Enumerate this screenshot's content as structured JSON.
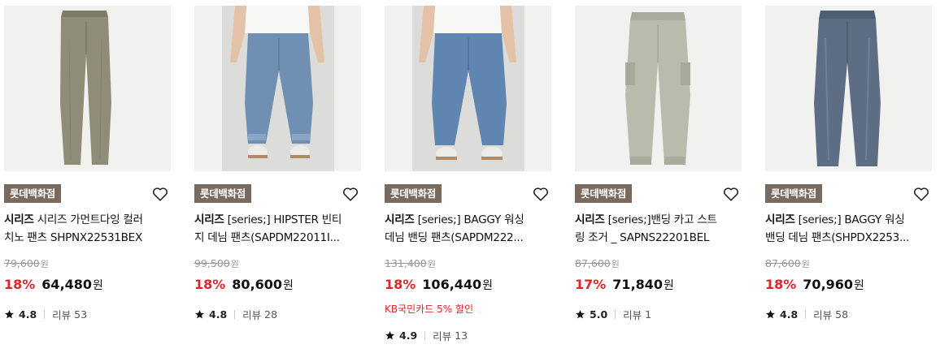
{
  "products": [
    {
      "badge": "롯데백화점",
      "brand": "시리즈",
      "title_line1": "시리즈 가먼트다잉 컬러",
      "title_line2": "치노 팬츠 SHPNX22531BEX",
      "original_price": "79,600",
      "discount": "18%",
      "price": "64,480",
      "currency": "원",
      "promo": "",
      "rating": "4.8",
      "review_label": "리뷰",
      "review_count": "53",
      "pant_color": "#8f8c78",
      "image": "khaki-chino-pants"
    },
    {
      "badge": "롯데백화점",
      "brand": "시리즈",
      "title_line1": "[series;] HIPSTER 빈티",
      "title_line2": "지 데님 팬츠(SAPDM22011I...",
      "original_price": "99,500",
      "discount": "18%",
      "price": "80,600",
      "currency": "원",
      "promo": "",
      "rating": "4.8",
      "review_label": "리뷰",
      "review_count": "28",
      "pant_color": "#6f90b3",
      "image": "model-light-denim"
    },
    {
      "badge": "롯데백화점",
      "brand": "시리즈",
      "title_line1": "[series;] BAGGY 워싱",
      "title_line2": "데님 밴딩 팬츠(SAPDM222...",
      "original_price": "131,400",
      "discount": "18%",
      "price": "106,440",
      "currency": "원",
      "promo": "KB국민카드 5% 할인",
      "rating": "4.9",
      "review_label": "리뷰",
      "review_count": "13",
      "pant_color": "#5f86b0",
      "image": "model-baggy-denim"
    },
    {
      "badge": "롯데백화점",
      "brand": "시리즈",
      "title_line1": "[series;]밴딩 카고 스트",
      "title_line2": "링 조거 _ SAPNS22201BEL",
      "original_price": "87,600",
      "discount": "17%",
      "price": "71,840",
      "currency": "원",
      "promo": "",
      "rating": "5.0",
      "review_label": "리뷰",
      "review_count": "1",
      "pant_color": "#b9bcad",
      "image": "cargo-jogger-pants"
    },
    {
      "badge": "롯데백화점",
      "brand": "시리즈",
      "title_line1": "[series;] BAGGY 워싱",
      "title_line2": "밴딩 데님 팬츠(SHPDX2253...",
      "original_price": "87,600",
      "discount": "18%",
      "price": "70,960",
      "currency": "원",
      "promo": "",
      "rating": "4.8",
      "review_label": "리뷰",
      "review_count": "58",
      "pant_color": "#5d6e84",
      "image": "grey-washed-denim"
    }
  ]
}
